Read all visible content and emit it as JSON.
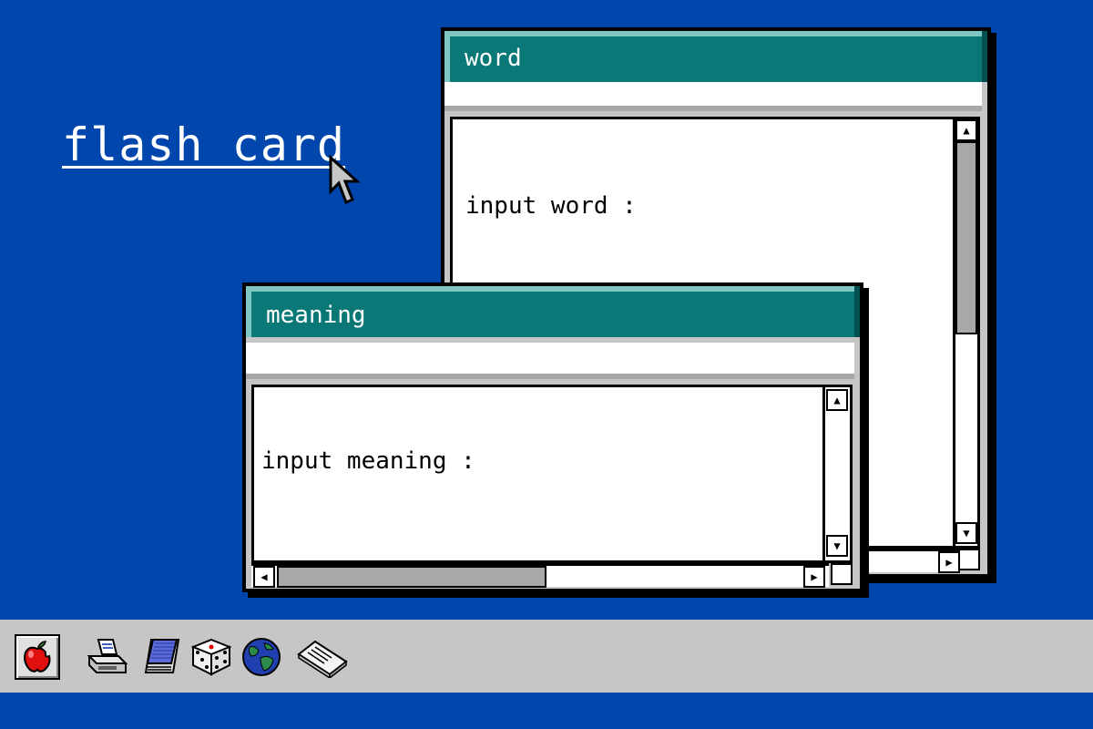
{
  "desktop": {
    "title_link": "flash card",
    "background_color": "#0046ad"
  },
  "windows": {
    "word": {
      "title": "word",
      "prompt": "input word :"
    },
    "meaning": {
      "title": "meaning",
      "prompt": "input meaning :"
    }
  },
  "taskbar": {
    "icons": [
      "apple-icon",
      "printer-icon",
      "notepad-icon",
      "dice-icon",
      "globe-icon",
      "scanner-icon"
    ]
  },
  "colors": {
    "titlebar": "#0a7877",
    "titlebar_highlight": "#7fc7c4",
    "taskbar": "#c6c6c6"
  }
}
